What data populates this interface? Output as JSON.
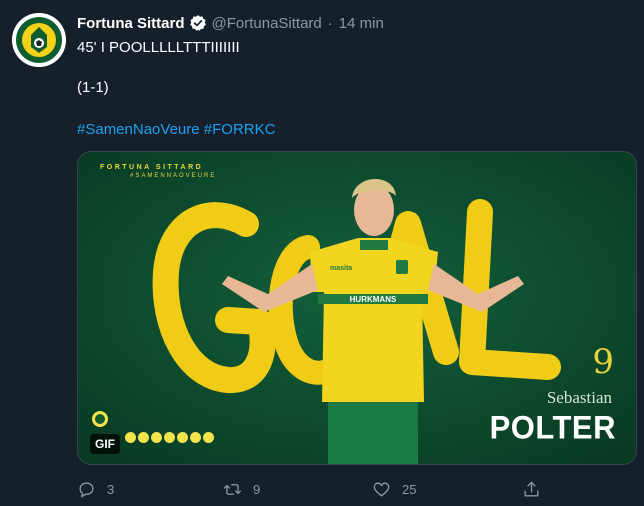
{
  "tweet": {
    "author_name": "Fortuna Sittard",
    "handle": "@FortunaSittard",
    "separator": "·",
    "time": "14 min",
    "line1": "45' I POOLLLLLTTTIIIIIII",
    "line2": "(1-1)",
    "hashtags": [
      "#SamenNaoVeure",
      "#FORRKC"
    ]
  },
  "media": {
    "brand": "FORTUNA SITTARD",
    "brand_sub": "#SAMENNAOVEURE",
    "goal_word": "GOAL",
    "jersey_number": "9",
    "first_name": "Sebastian",
    "last_name": "POLTER",
    "shirt_sponsor": "HURKMANS",
    "kit_brand": "masita",
    "gif_label": "GIF"
  },
  "actions": {
    "reply_count": "3",
    "retweet_count": "9",
    "like_count": "25"
  },
  "colors": {
    "background": "#15202b",
    "muted": "#8899a6",
    "link": "#1da1f2",
    "pitch_green": "#0e4a30",
    "club_yellow": "#f1cc17"
  }
}
